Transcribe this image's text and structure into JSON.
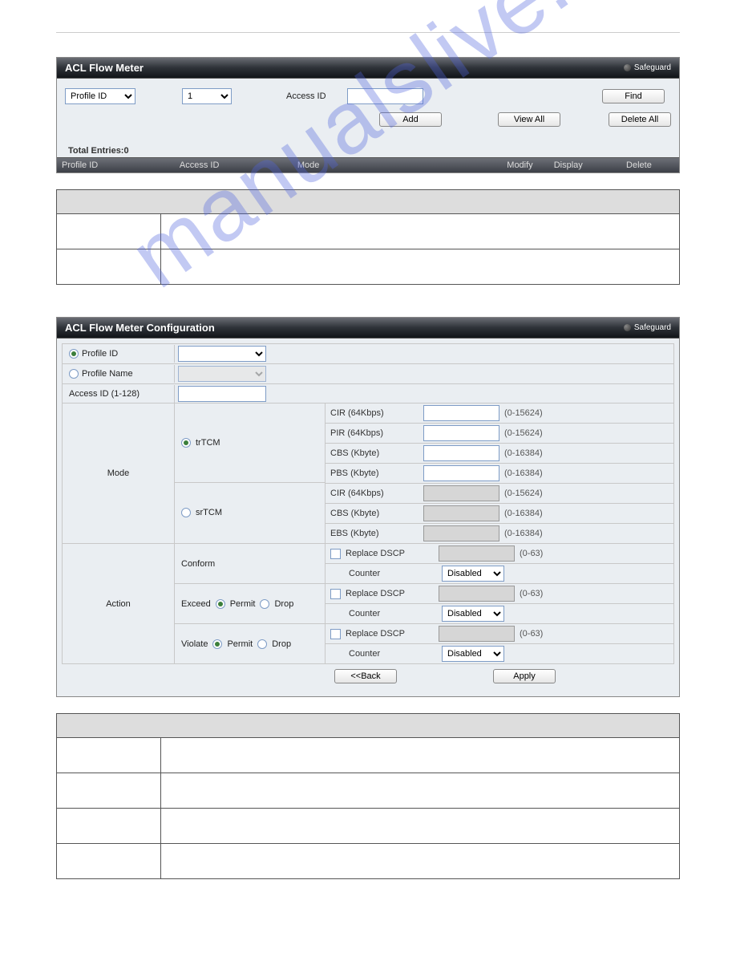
{
  "watermark": "manualslive.com",
  "panel1": {
    "title": "ACL Flow Meter",
    "safeguard": "Safeguard",
    "profile_id_label": "Profile ID",
    "profile_id_value": "1",
    "access_id_label": "Access ID",
    "access_id_value": "",
    "find_btn": "Find",
    "add_btn": "Add",
    "view_all_btn": "View All",
    "delete_all_btn": "Delete All",
    "total_entries": "Total Entries:0",
    "cols": {
      "c1": "Profile ID",
      "c2": "Access ID",
      "c3": "Mode",
      "c4": "Modify",
      "c5": "Display",
      "c6": "Delete"
    }
  },
  "panel2": {
    "title": "ACL Flow Meter Configuration",
    "safeguard": "Safeguard",
    "profile_id_label": "Profile ID",
    "profile_name_label": "Profile Name",
    "access_id_label": "Access ID (1-128)",
    "mode_label": "Mode",
    "action_label": "Action",
    "trtcm": "trTCM",
    "srtcm": "srTCM",
    "params": {
      "cir": "CIR (64Kbps)",
      "cir_range": "(0-15624)",
      "pir": "PIR (64Kbps)",
      "pir_range": "(0-15624)",
      "cbs": "CBS (Kbyte)",
      "cbs_range": "(0-16384)",
      "pbs": "PBS (Kbyte)",
      "pbs_range": "(0-16384)",
      "cir2": "CIR (64Kbps)",
      "cir2_range": "(0-15624)",
      "cbs2": "CBS (Kbyte)",
      "cbs2_range": "(0-16384)",
      "ebs": "EBS (Kbyte)",
      "ebs_range": "(0-16384)"
    },
    "conform": "Conform",
    "exceed": "Exceed",
    "violate": "Violate",
    "permit": "Permit",
    "drop": "Drop",
    "replace_dscp": "Replace DSCP",
    "dscp_range": "(0-63)",
    "counter": "Counter",
    "counter_val": "Disabled",
    "back_btn": "<<Back",
    "apply_btn": "Apply"
  }
}
